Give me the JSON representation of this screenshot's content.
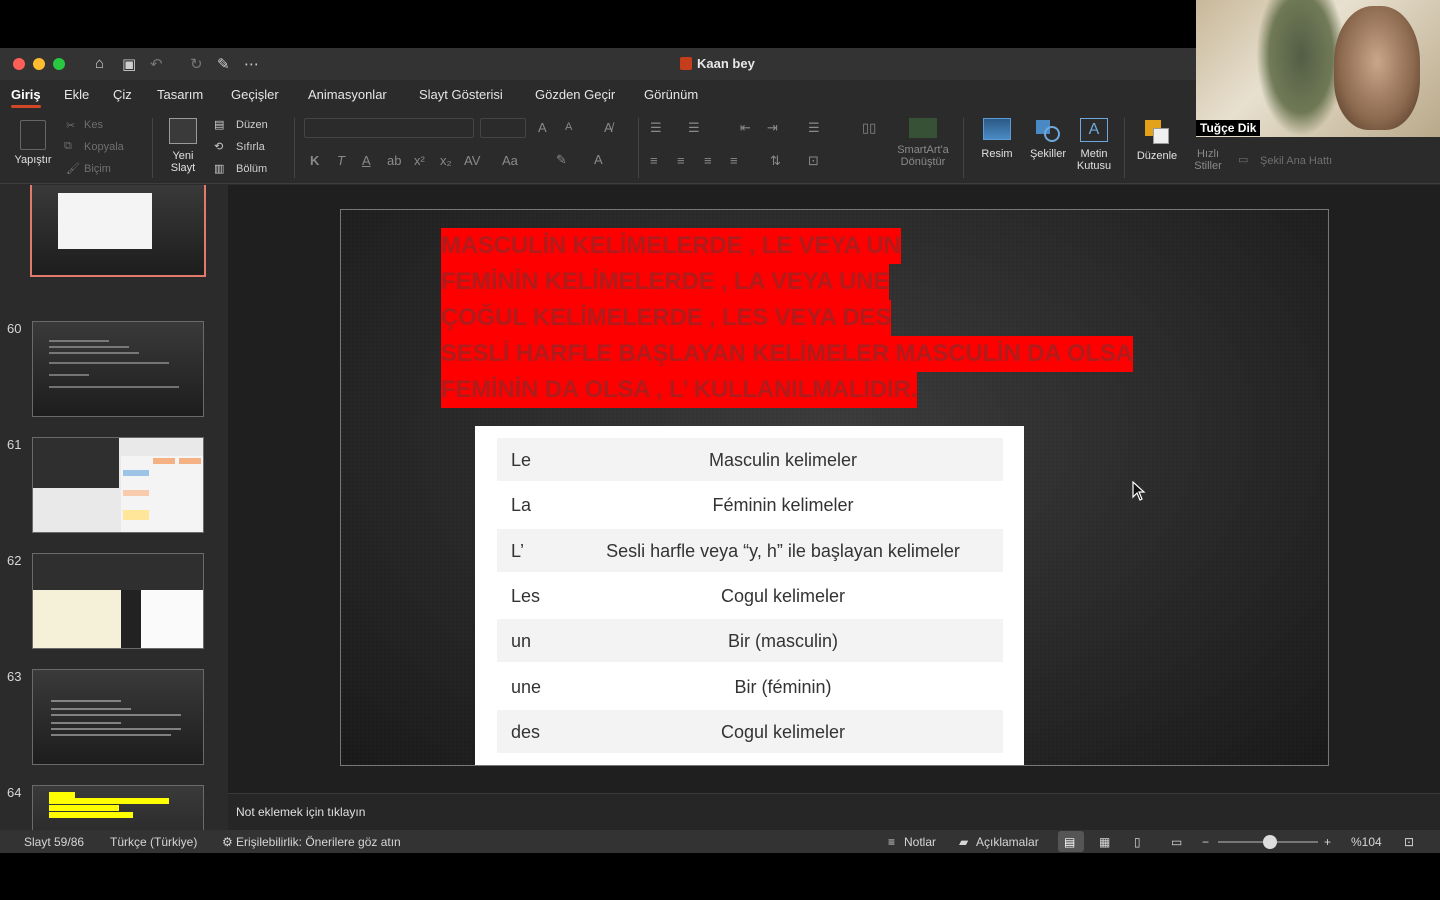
{
  "window": {
    "title": "Kaan bey"
  },
  "tabs": [
    "Giriş",
    "Ekle",
    "Çiz",
    "Tasarım",
    "Geçişler",
    "Animasyonlar",
    "Slayt Gösterisi",
    "Gözden Geçir",
    "Görünüm"
  ],
  "ribbon": {
    "paste": "Yapıştır",
    "cut": "Kes",
    "copy": "Kopyala",
    "format": "Biçim",
    "new_slide_1": "Yeni",
    "new_slide_2": "Slayt",
    "layout": "Düzen",
    "reset": "Sıfırla",
    "section": "Bölüm",
    "bold": "K",
    "italic": "T",
    "smartart_1": "SmartArt'a",
    "smartart_2": "Dönüştür",
    "picture": "Resim",
    "shapes": "Şekiller",
    "textbox_1": "Metin",
    "textbox_2": "Kutusu",
    "arrange": "Düzenle",
    "quick_styles_1": "Hızlı",
    "quick_styles_2": "Stiller",
    "shape_outline": "Şekil Ana Hattı"
  },
  "thumbnails": [
    {
      "num": "",
      "selected": true
    },
    {
      "num": "60"
    },
    {
      "num": "61"
    },
    {
      "num": "62"
    },
    {
      "num": "63"
    },
    {
      "num": "64"
    }
  ],
  "slide": {
    "heading_lines": [
      "MASCULİN KELİMELERDE , LE VEYA UN",
      "FEMİNİN KELİMELERDE , LA VEYA UNE",
      "ÇOĞUL KELİMELERDE , LES VEYA DES",
      "SESLİ HARFLE BAŞLAYAN KELİMELER MASCULİN DA OLSA",
      "FEMİNİN DA OLSA , L’ KULLANILMALIDIR."
    ],
    "table": [
      {
        "article": "Le",
        "meaning": "Masculin kelimeler"
      },
      {
        "article": "La",
        "meaning": "Féminin kelimeler"
      },
      {
        "article": "L’",
        "meaning": "Sesli harfle veya “y, h” ile başlayan kelimeler"
      },
      {
        "article": "Les",
        "meaning": "Cogul kelimeler"
      },
      {
        "article": "un",
        "meaning": "Bir (masculin)"
      },
      {
        "article": "une",
        "meaning": "Bir (féminin)"
      },
      {
        "article": "des",
        "meaning": "Cogul kelimeler"
      }
    ]
  },
  "notes": {
    "placeholder": "Not eklemek için tıklayın"
  },
  "status": {
    "slide": "Slayt 59/86",
    "language": "Türkçe (Türkiye)",
    "accessibility": "Erişilebilirlik: Önerilere göz atın",
    "notes": "Notlar",
    "comments": "Açıklamalar",
    "zoom": "%104",
    "zoom_fraction": 0.52
  },
  "video": {
    "participant": "Tuğçe Dik"
  },
  "colors": {
    "accent": "#d24726",
    "highlight": "#ff0000",
    "heading_text": "#b01c1c"
  }
}
